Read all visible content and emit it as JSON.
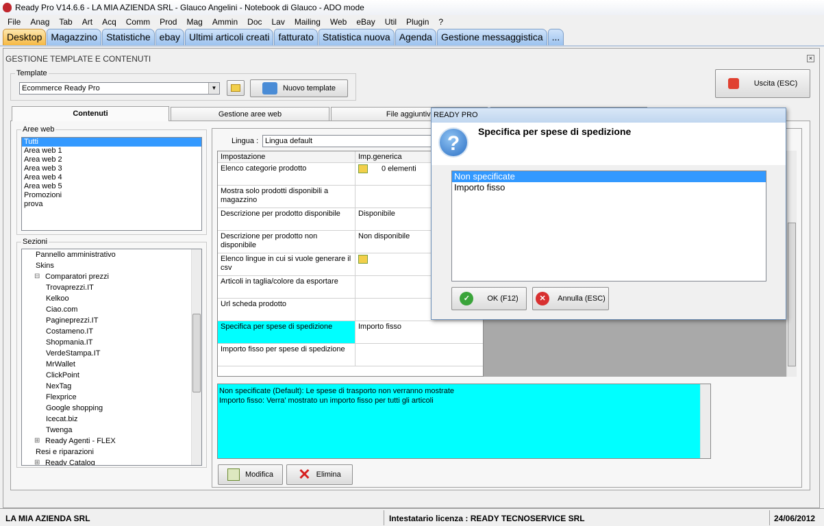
{
  "window_title": "Ready Pro V14.6.6 - LA MIA AZIENDA SRL - Glauco Angelini - Notebook di Glauco - ADO mode",
  "menu": [
    "File",
    "Anag",
    "Tab",
    "Art",
    "Acq",
    "Comm",
    "Prod",
    "Mag",
    "Ammin",
    "Doc",
    "Lav",
    "Mailing",
    "Web",
    "eBay",
    "Util",
    "Plugin",
    "?"
  ],
  "tabs": [
    "Desktop",
    "Magazzino",
    "Statistiche",
    "ebay",
    "Ultimi articoli creati",
    "fatturato",
    "Statistica nuova",
    "Agenda",
    "Gestione messaggistica",
    "..."
  ],
  "panel": {
    "title": "GESTIONE TEMPLATE E CONTENUTI",
    "template_label": "Template",
    "template_value": "Ecommerce Ready Pro",
    "new_template": "Nuovo template",
    "exit": "Uscita (ESC)",
    "subtabs": [
      "Contenuti",
      "Gestione aree web",
      "File aggiuntivi",
      ""
    ],
    "aree_label": "Aree web",
    "aree": [
      "Tutti",
      "Area web 1",
      "Area web 2",
      "Area web 3",
      "Area web 4",
      "Area web 5",
      "Promozioni",
      "prova"
    ],
    "sezioni_label": "Sezioni",
    "tree": [
      {
        "t": "Pannello amministrativo",
        "lvl": 1
      },
      {
        "t": "Skins",
        "lvl": 1
      },
      {
        "t": "Comparatori prezzi",
        "lvl": 1,
        "exp": "-"
      },
      {
        "t": "Trovaprezzi.IT",
        "lvl": 2
      },
      {
        "t": "Kelkoo",
        "lvl": 2
      },
      {
        "t": "Ciao.com",
        "lvl": 2
      },
      {
        "t": "Pagineprezzi.IT",
        "lvl": 2
      },
      {
        "t": "Costameno.IT",
        "lvl": 2
      },
      {
        "t": "Shopmania.IT",
        "lvl": 2
      },
      {
        "t": "VerdeStampa.IT",
        "lvl": 2
      },
      {
        "t": "MrWallet",
        "lvl": 2
      },
      {
        "t": "ClickPoint",
        "lvl": 2
      },
      {
        "t": "NexTag",
        "lvl": 2
      },
      {
        "t": "Flexprice",
        "lvl": 2
      },
      {
        "t": "Google shopping",
        "lvl": 2
      },
      {
        "t": "Icecat.biz",
        "lvl": 2
      },
      {
        "t": "Twenga",
        "lvl": 2
      },
      {
        "t": "Ready Agenti - FLEX",
        "lvl": 1,
        "exp": "+"
      },
      {
        "t": "Resi e riparazioni",
        "lvl": 1
      },
      {
        "t": "Ready Catalog",
        "lvl": 1,
        "exp": "+"
      }
    ],
    "lingua_label": "Lingua :",
    "lingua_value": "Lingua default",
    "grid_headers": [
      "Impostazione",
      "Imp.generica"
    ],
    "grid_rows": [
      [
        "Elenco categorie prodotto",
        "0 elementi"
      ],
      [
        "Mostra solo prodotti disponibili a magazzino",
        ""
      ],
      [
        "Descrizione per prodotto disponibile",
        "Disponibile"
      ],
      [
        "Descrizione per prodotto non disponibile",
        "Non disponibile"
      ],
      [
        "Elenco lingue in cui si vuole generare il csv",
        ""
      ],
      [
        "Articoli in taglia/colore da esportare",
        ""
      ],
      [
        "Url scheda prodotto",
        ""
      ],
      [
        "Specifica per spese di spedizione",
        "Importo fisso"
      ],
      [
        "Importo fisso per spese di spedizione",
        ""
      ]
    ],
    "description": [
      "Non specificate (Default): Le spese di trasporto non verranno mostrate",
      "Importo fisso: Verra' mostrato un importo fisso per tutti gli articoli"
    ],
    "modifica": "Modifica",
    "elimina": "Elimina"
  },
  "dialog": {
    "title": "READY PRO",
    "heading": "Specifica per spese di spedizione",
    "options": [
      "Non specificate",
      "Importo fisso"
    ],
    "ok": "OK (F12)",
    "cancel": "Annulla (ESC)"
  },
  "status": {
    "company": "LA MIA AZIENDA SRL",
    "license": "Intestatario licenza : READY TECNOSERVICE SRL",
    "date": "24/06/2012"
  },
  "colors": {
    "selected_row": "#00ffff",
    "tab_active": "#f6b944",
    "tab": "#9dc3ef"
  }
}
